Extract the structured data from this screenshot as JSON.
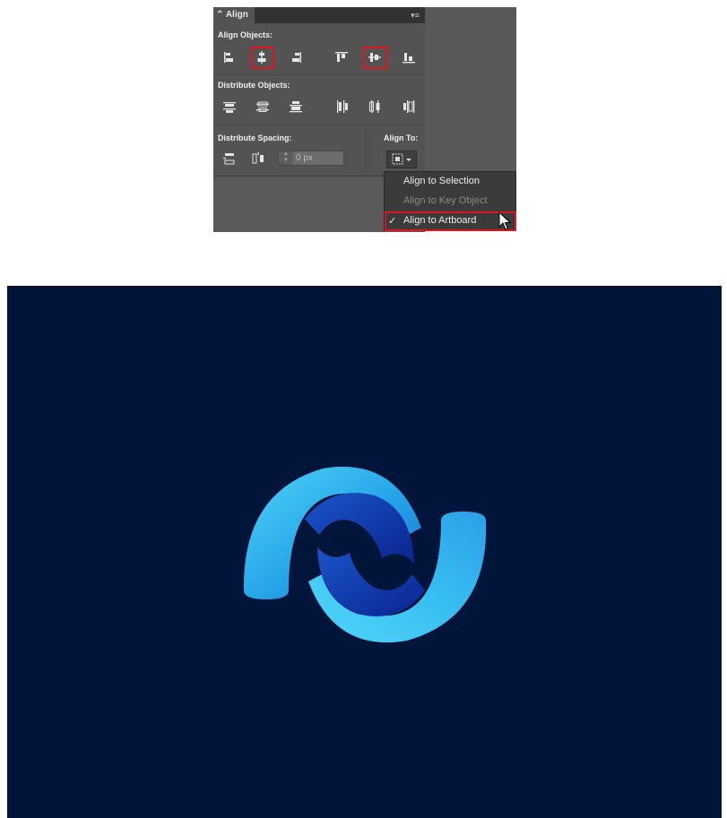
{
  "panel": {
    "tab_label": "Align",
    "tab_chevron": "⌃",
    "menu_glyph": "▾≡",
    "align_objects_label": "Align Objects:",
    "distribute_objects_label": "Distribute Objects:",
    "distribute_spacing_label": "Distribute Spacing:",
    "align_to_label": "Align To:",
    "spacing_value": "0 px",
    "icons": {
      "align_objects": [
        "horizontal-align-left-icon",
        "horizontal-align-center-icon",
        "horizontal-align-right-icon",
        "vertical-align-top-icon",
        "vertical-align-center-icon",
        "vertical-align-bottom-icon"
      ],
      "distribute_objects": [
        "vertical-distribute-top-icon",
        "vertical-distribute-center-icon",
        "vertical-distribute-bottom-icon",
        "horizontal-distribute-left-icon",
        "horizontal-distribute-center-icon",
        "horizontal-distribute-right-icon"
      ],
      "distribute_spacing": [
        "vertical-distribute-space-icon",
        "horizontal-distribute-space-icon"
      ],
      "align_to": "align-to-artboard-icon"
    },
    "highlighted": [
      "horizontal-align-center-icon",
      "vertical-align-center-icon",
      "align-to-artboard-option"
    ]
  },
  "dropdown": {
    "items": [
      {
        "label": "Align to Selection",
        "enabled": true,
        "checked": false
      },
      {
        "label": "Align to Key Object",
        "enabled": false,
        "checked": false
      },
      {
        "label": "Align to Artboard",
        "enabled": true,
        "checked": true
      }
    ],
    "check_glyph": "✓"
  },
  "colors": {
    "panel_bg": "#535353",
    "highlight": "#e0131e",
    "artboard_bg": "#01153a",
    "logo_light": "#33c3f0",
    "logo_dark": "#0b2fa3"
  }
}
